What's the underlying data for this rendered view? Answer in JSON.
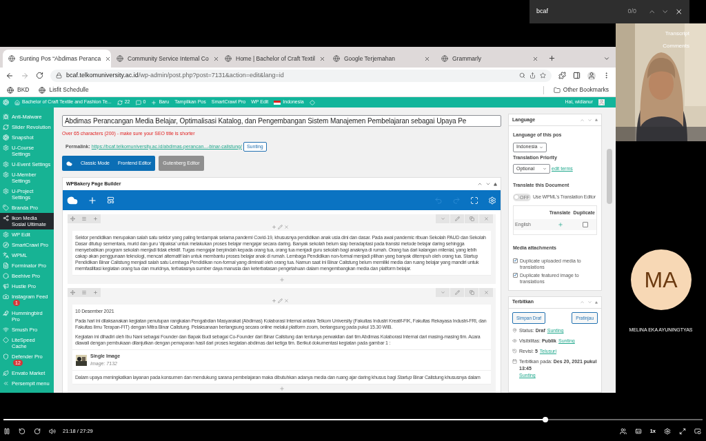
{
  "find_bar": {
    "query": "bcaf",
    "count": "0/0"
  },
  "browser": {
    "tabs": [
      {
        "title": "Sunting Pos “Abdimas Peranca",
        "selected": true
      },
      {
        "title": "Community Service Internal Co",
        "selected": false
      },
      {
        "title": "Home | Bachelor of Craft Textil",
        "selected": false
      },
      {
        "title": "Google Terjemahan",
        "selected": false
      },
      {
        "title": "Grammarly",
        "selected": false
      }
    ],
    "address": {
      "host": "bcaf.telkomuniversity.ac.id",
      "path": "/wp-admin/post.php?post=7131&action=edit&lang=id"
    },
    "bookmarks": [
      "BKD",
      "Lisfit Schedulle"
    ],
    "other_bookmarks": "Other Bookmarks"
  },
  "admin_bar": {
    "site": "Bachelor of Craft Textile and Fashion Te...",
    "updates": "22",
    "comments": "0",
    "new": "Baru",
    "links": [
      "Tampilkan Pos",
      "SmartCrawl Pro",
      "WP Edit"
    ],
    "language": "Indonesia",
    "greeting": "Hai, widianur"
  },
  "sidebar": {
    "items": [
      {
        "label": "Anti-Malware",
        "selected": false
      },
      {
        "label": "Slider Revolution",
        "selected": false
      },
      {
        "label": "Snapshot",
        "selected": false
      },
      {
        "label": "U-Course Settings",
        "selected": false
      },
      {
        "label": "U-Event Settings",
        "selected": false
      },
      {
        "label": "U-Member Settings",
        "selected": false
      },
      {
        "label": "U-Project Settings",
        "selected": false
      },
      {
        "label": "Branda Pro",
        "selected": false
      },
      {
        "label": "Ikon Media Sosial Ultimate",
        "selected": true
      },
      {
        "label": "WP Edit",
        "selected": false
      },
      {
        "label": "SmartCrawl Pro",
        "selected": false
      },
      {
        "label": "WPML",
        "selected": false
      },
      {
        "label": "Forminator Pro",
        "selected": false
      },
      {
        "label": "Beehive Pro",
        "selected": false
      },
      {
        "label": "Hustle Pro",
        "selected": false
      },
      {
        "label": "Instagram Feed",
        "selected": false,
        "badge": "1"
      },
      {
        "label": "Hummingbird Pro",
        "selected": false
      },
      {
        "label": "Smush Pro",
        "selected": false
      },
      {
        "label": "LiteSpeed Cache",
        "selected": false
      },
      {
        "label": "Defender Pro",
        "selected": false,
        "badge": "12"
      },
      {
        "label": "Envato Market",
        "selected": false
      },
      {
        "label": "Persempit menu",
        "selected": false
      }
    ]
  },
  "editor": {
    "title": "Abdimas Perancangan Media Belajar, Optimalisasi Katalog, dan Pengembangan Sistem Manajemen Pembelajaran sebagai Upaya Pe",
    "seo_warning": "Over 65 characters (200) - make sure your SEO title is shorter",
    "permalink": {
      "label": "Permalink:",
      "url": "https://bcaf.telkomuniversity.ac.id/abdimas-perancan...-binar-calistung/",
      "button": "Sunting"
    },
    "mode_buttons": [
      "Classic Mode",
      "Frontend Editor"
    ],
    "gutenberg_button": "Gutenberg Editor",
    "builder": {
      "title": "WPBakery Page Builder",
      "rows": [
        {
          "elements": [
            {
              "kind": "text",
              "paragraphs": [
                "Sektor pendidikan merupakan salah satu sektor yang paling terdampak selama pandemi Covid-19, khususnya pendidikan anak usia dini dan dasar. Pada awal pandemic ribuan Sekolah PAUD dan Sekolah Dasar ditutup sementara, murid dan guru 'dipaksa' untuk melakukan proses belajar mengajar secara daring. Banyak sekolah belum siap beradaptasi pada transisi metode belajar daring sehingga menyebabkan program sekolah menjadi tidak efektif. Tugas mengajar berpindah kepada orang tua, orang tua menjadi guru sekolah bagi anaknya di rumah. Orang tua dari kalangan milenial, yang lebih cakap akan penggunaan teknologi, mencari alternatif lain untuk membantu proses belajar anak di rumah. Lembaga Pendidikan non-formal menjadi pilihan yang banyak ditempuh oleh orang tua. Startup Pendidikan Binar Calistung menjadi salah satu Lembaga Pendidikan non-formal yang diminati oleh orang tua. Namun saat ini Binar Calistung belum memiliki media dan ruang belajar yang mandiri untuk memfasilitasi kegiatan orang tua dan muridnya, terbatasnya sumber daya manusia dan keterbatasan pengetahuan dalam mengembangkan media dan platform belajar."
              ]
            }
          ]
        },
        {
          "elements": [
            {
              "kind": "text",
              "paragraphs": [
                "10 Desember 2021",
                "Pada hari ini dilaksanakan kegiatan penutupan rangkaian Pengabdian Masyarakat (Abdimas) Kolaborasi Internal antara Telkom University (Fakultas Industri Kreatif-FIK, Fakultas Rekayasa Industri-FRI, dan Fakultas Ilmu Terapan-FIT) dengan Mitra Binar Calistung. Pelaksanaan berlangsung secara online melalui platform zoom, berlangsung pada pukul 15.30 WIB.",
                "Kegiatan ini dihadiri oleh Ibu Nani sebagai Founder dan Bapak Budi sebagai Co-Founder dari Binar Calistung dan tentunya perwakilan dari tim Abdimas Kolaborasi Internal dari masing-masing tim. Acara diawali dengan pembukaan dilanjutkan dengan pemaparan hasil dari proses kegiatan abdimas dari ketiga tim. Berikut dokumentasi kegiatan pada gambar 1 :"
              ]
            },
            {
              "title": "Single Image",
              "caption": "Image: 7132"
            },
            {
              "kind": "text",
              "paragraphs": [
                "Dalam upaya meningkatkan layanan pada konsumen dan mendukung sarana pembelajaran maka dibutuhkan adanya media dan ruang ajar daring khusus bagi *Startup* Binar Calistung khususnya dalam"
              ]
            }
          ]
        }
      ]
    }
  },
  "language_box": {
    "title": "Language",
    "language_label": "Language of this pos",
    "language": "Indonesia",
    "priority_label": "Translation Priority",
    "priority": "Optional",
    "edit_terms": "edit terms",
    "translate_heading": "Translate this Document",
    "toggle": {
      "on": false,
      "label": "OFF"
    },
    "toggle_text": "Use WPML's Translation Editor",
    "columns": [
      "Translate",
      "Duplicate"
    ],
    "rows": [
      {
        "language": "English",
        "duplicate": false
      }
    ],
    "media_heading": "Media attachments",
    "media_options": [
      {
        "label": "Duplicate uploaded media to translations",
        "checked": true
      },
      {
        "label": "Duplicate featured image to translations",
        "checked": true
      }
    ]
  },
  "publish_box": {
    "title": "Terbitkan",
    "save": "Simpan Draf",
    "preview": "Pratinjau",
    "lines": [
      {
        "kind": "status",
        "text": "Status: **Draf**",
        "link": "Sunting"
      },
      {
        "kind": "visibility",
        "text": "Visibilitas: **Publik**",
        "link": "Sunting"
      },
      {
        "kind": "revisions",
        "text": "Revisi: **5**",
        "link": "Telusuri"
      },
      {
        "kind": "date",
        "text": "Terbitkan pada: **Des 20, 2021 pukul 13:45**",
        "link": "Sunting"
      }
    ]
  },
  "video": {
    "overlay_links": [
      "Transcript",
      "Comments"
    ],
    "participant": {
      "initials": "MA",
      "name": "MELINA EKA AYUNINGTYAS"
    }
  },
  "player": {
    "level": 0.775,
    "time": "21:18 / 27:29",
    "speed": "1x"
  }
}
